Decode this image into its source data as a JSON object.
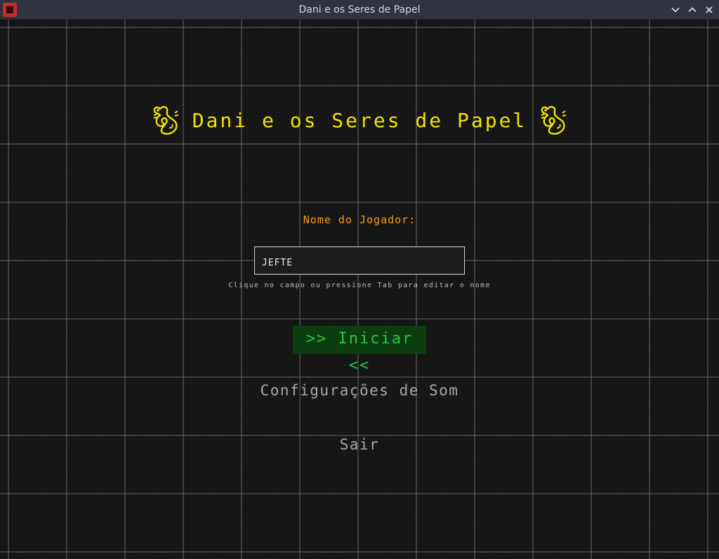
{
  "window": {
    "title": "Dani e os Seres de Papel",
    "controls": [
      "minimize",
      "maximize",
      "close"
    ]
  },
  "game": {
    "title": "Dani e os Seres de Papel",
    "title_icon": "dragon-icon",
    "player_label": "Nome do Jogador:",
    "player_name": "JEFTE",
    "hint": "Clique no campo ou pressione Tab para editar o nome",
    "menu": {
      "start_label": ">> Iniciar <<",
      "sound_label": "Configurações de Som",
      "exit_label": "Sair"
    }
  },
  "colors": {
    "title": "#f2e200",
    "player_label": "#ff9a1a",
    "selected_menu_text": "#27c445",
    "selected_menu_bg": "#0c3d10",
    "menu_text": "#a9a9a9",
    "grid": "#5f5f5f",
    "background": "#151515"
  }
}
